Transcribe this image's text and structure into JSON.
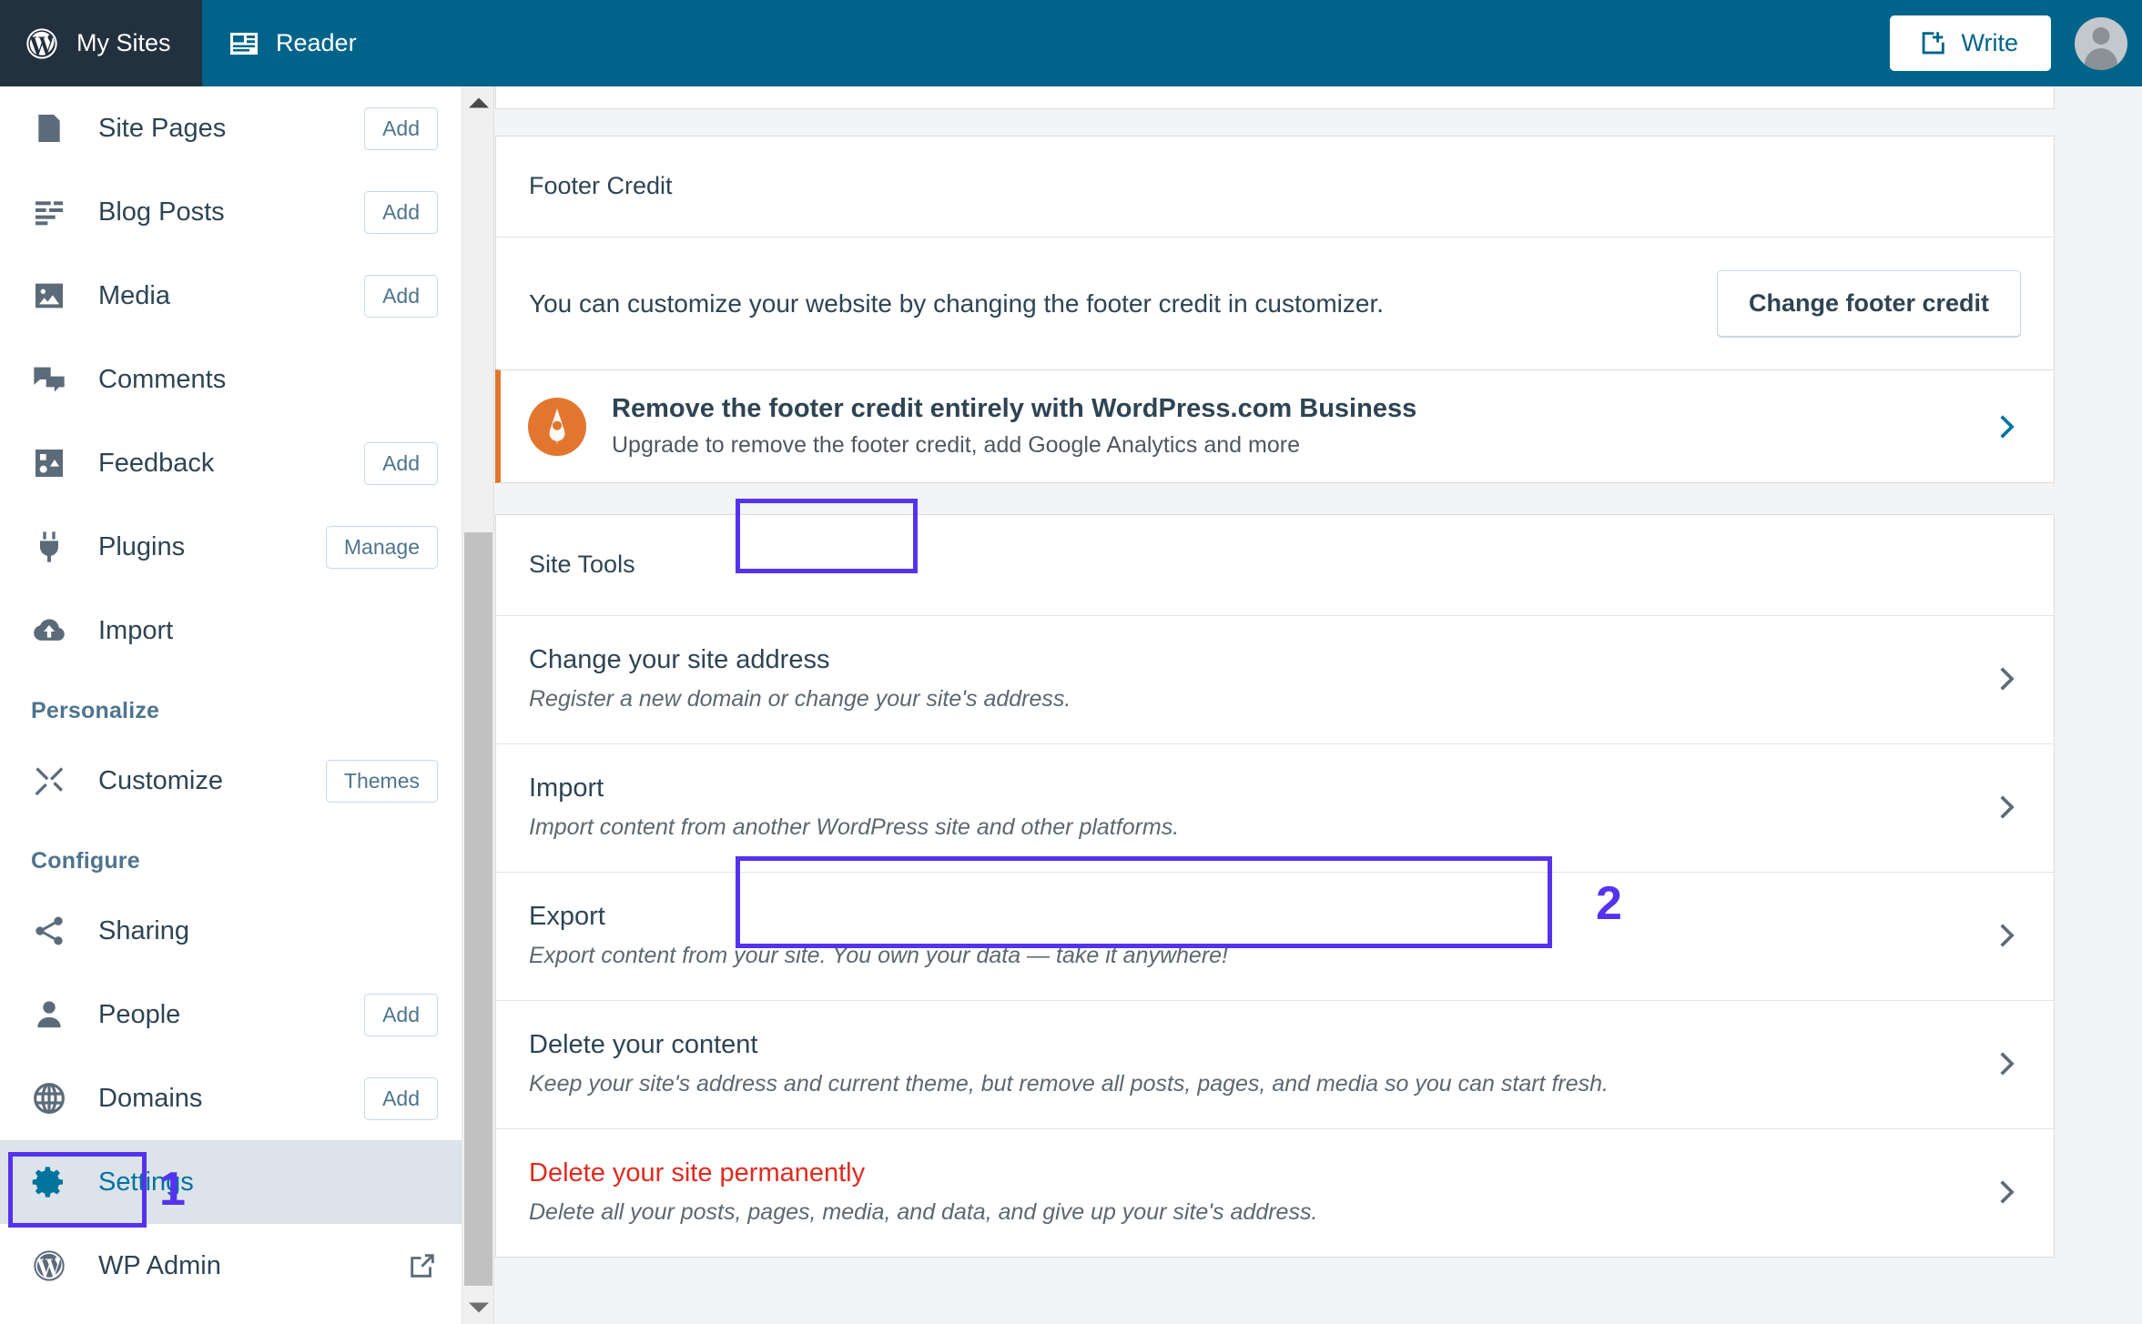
{
  "masthead": {
    "my_sites": "My Sites",
    "reader": "Reader",
    "write": "Write"
  },
  "sidebar": {
    "items": [
      {
        "label": "Site Pages",
        "icon": "page-icon",
        "action": "Add"
      },
      {
        "label": "Blog Posts",
        "icon": "posts-icon",
        "action": "Add"
      },
      {
        "label": "Media",
        "icon": "media-icon",
        "action": "Add"
      },
      {
        "label": "Comments",
        "icon": "comments-icon",
        "action": ""
      },
      {
        "label": "Feedback",
        "icon": "feedback-icon",
        "action": "Add"
      },
      {
        "label": "Plugins",
        "icon": "plugin-icon",
        "action": "Manage"
      },
      {
        "label": "Import",
        "icon": "cloud-upload-icon",
        "action": ""
      }
    ],
    "personalize_heading": "Personalize",
    "personalize_items": [
      {
        "label": "Customize",
        "icon": "customize-icon",
        "action": "Themes"
      }
    ],
    "configure_heading": "Configure",
    "configure_items": [
      {
        "label": "Sharing",
        "icon": "share-icon",
        "action": ""
      },
      {
        "label": "People",
        "icon": "person-icon",
        "action": "Add"
      },
      {
        "label": "Domains",
        "icon": "globe-icon",
        "action": "Add"
      },
      {
        "label": "Settings",
        "icon": "gear-icon",
        "action": ""
      },
      {
        "label": "WP Admin",
        "icon": "wordpress-icon",
        "action": ""
      }
    ]
  },
  "footer_credit": {
    "heading": "Footer Credit",
    "description": "You can customize your website by changing the footer credit in customizer.",
    "button": "Change footer credit"
  },
  "upgrade_banner": {
    "title": "Remove the footer credit entirely with WordPress.com Business",
    "subtitle": "Upgrade to remove the footer credit, add Google Analytics and more",
    "accent_color": "#e2762e",
    "chevron_color": "#00739e"
  },
  "site_tools": {
    "heading": "Site Tools",
    "rows": [
      {
        "title": "Change your site address",
        "description": "Register a new domain or change your site's address.",
        "danger": false
      },
      {
        "title": "Import",
        "description": "Import content from another WordPress site and other platforms.",
        "danger": false
      },
      {
        "title": "Export",
        "description": "Export content from your site. You own your data — take it anywhere!",
        "danger": false
      },
      {
        "title": "Delete your content",
        "description": "Keep your site's address and current theme, but remove all posts, pages, and media so you can start fresh.",
        "danger": false
      },
      {
        "title": "Delete your site permanently",
        "description": "Delete all your posts, pages, media, and data, and give up your site's address.",
        "danger": true
      }
    ]
  },
  "annotations": {
    "color": "#5533ee",
    "markers": [
      {
        "number": "1",
        "target": "Settings"
      },
      {
        "number": "2",
        "target": "Export"
      }
    ]
  },
  "colors": {
    "masthead": "#00648a",
    "masthead_dark": "#23303d",
    "active_row": "#dce3ea",
    "link": "#00739e",
    "danger": "#e02b20"
  }
}
